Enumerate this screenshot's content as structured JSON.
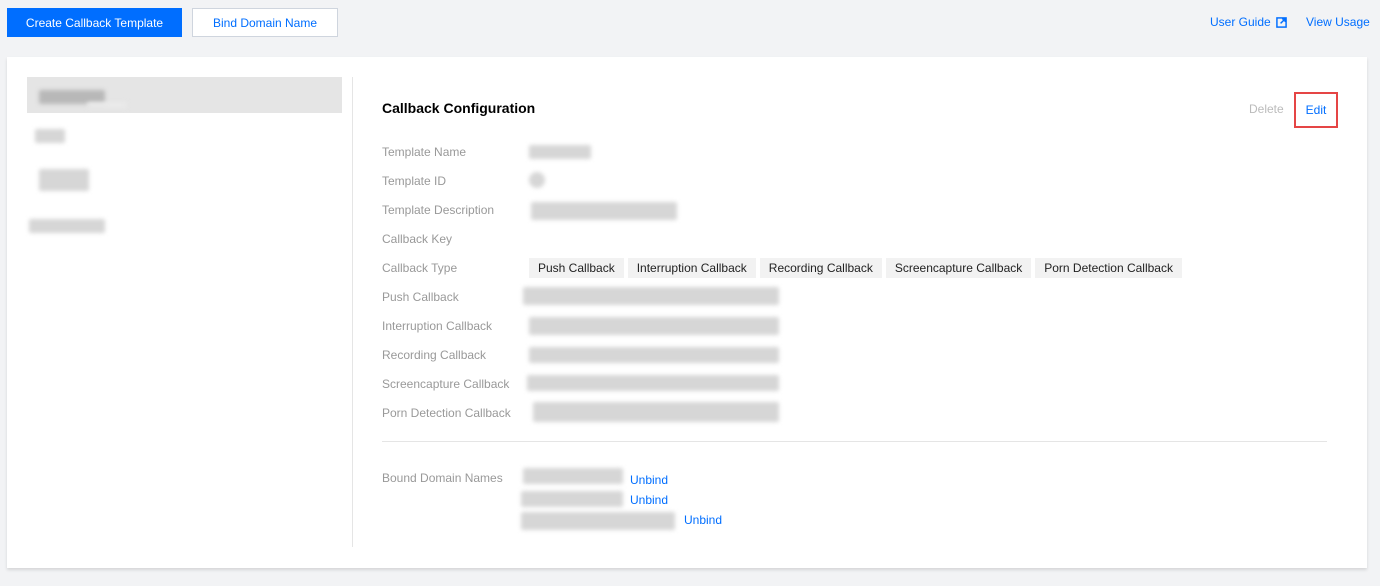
{
  "toolbar": {
    "create_label": "Create Callback Template",
    "bind_label": "Bind Domain Name",
    "user_guide_label": "User Guide",
    "view_usage_label": "View Usage",
    "user_guide_icon": "external-link-icon"
  },
  "detail": {
    "title": "Callback Configuration",
    "delete_label": "Delete",
    "edit_label": "Edit",
    "fields": {
      "template_name": "Template Name",
      "template_id": "Template ID",
      "template_description": "Template Description",
      "callback_key": "Callback Key",
      "callback_type": "Callback Type",
      "push_callback": "Push Callback",
      "interruption_callback": "Interruption Callback",
      "recording_callback": "Recording Callback",
      "screencapture_callback": "Screencapture Callback",
      "porn_detection_callback": "Porn Detection Callback"
    },
    "callback_types": [
      "Push Callback",
      "Interruption Callback",
      "Recording Callback",
      "Screencapture Callback",
      "Porn Detection Callback"
    ],
    "bound_domains_label": "Bound Domain Names",
    "unbind_label": "Unbind"
  },
  "colors": {
    "primary": "#006eff",
    "highlight_border": "#e54545"
  }
}
